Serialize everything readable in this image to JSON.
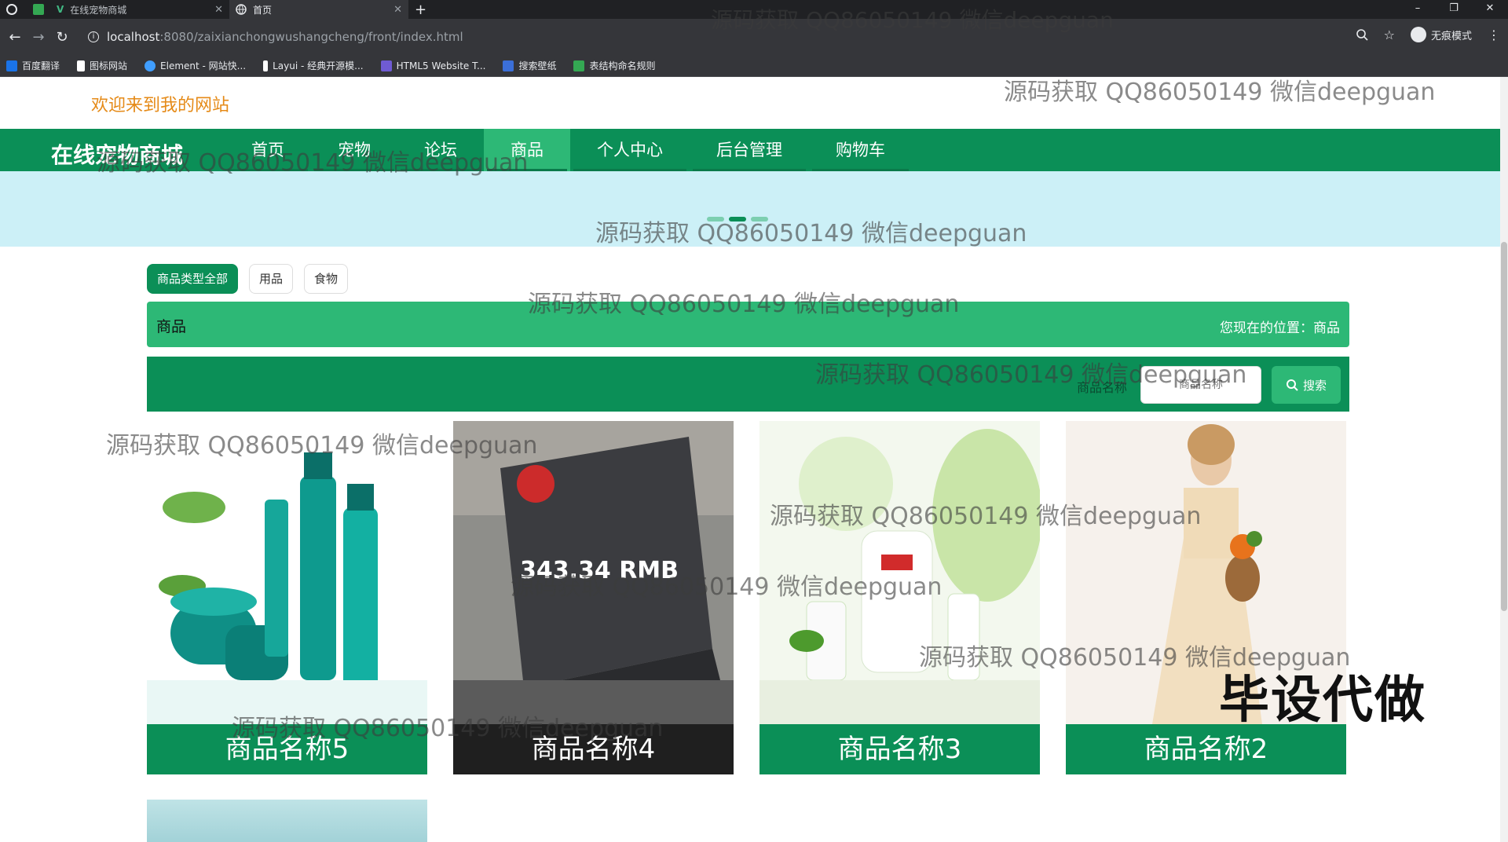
{
  "browser": {
    "tabs": [
      {
        "title": "在线宠物商城",
        "active": false
      },
      {
        "title": "首页",
        "active": true
      }
    ],
    "new_tab": "+",
    "url_host": "localhost",
    "url_path": ":8080/zaixianchongwushangcheng/front/index.html",
    "profile_label": "无痕模式",
    "bookmarks": [
      {
        "label": "百度翻译",
        "color": "#1a73e8"
      },
      {
        "label": "图标网站",
        "color": "#ffffff"
      },
      {
        "label": "Element - 网站快...",
        "color": "#409eff"
      },
      {
        "label": "Layui - 经典开源模...",
        "color": "#ffffff"
      },
      {
        "label": "HTML5 Website T...",
        "color": "#6f5bd3"
      },
      {
        "label": "搜索壁纸",
        "color": "#3b6fd8"
      },
      {
        "label": "表结构命名规则",
        "color": "#34a853"
      }
    ]
  },
  "site": {
    "welcome": "欢迎来到我的网站",
    "logo": "在线宠物商城",
    "nav": [
      {
        "label": "首页",
        "active": false
      },
      {
        "label": "宠物",
        "active": false
      },
      {
        "label": "论坛",
        "active": false
      },
      {
        "label": "商品",
        "active": true
      },
      {
        "label": "个人中心",
        "active": false
      },
      {
        "label": "后台管理",
        "active": false
      },
      {
        "label": "购物车",
        "active": false
      }
    ],
    "filters": [
      {
        "label": "商品类型全部",
        "active": true
      },
      {
        "label": "用品",
        "active": false
      },
      {
        "label": "食物",
        "active": false
      }
    ],
    "crumb_title": "商品",
    "location_text": "您现在的位置：商品",
    "search": {
      "label": "商品名称",
      "placeholder": "商品名称",
      "button": "搜索"
    },
    "products": [
      {
        "name": "商品名称5",
        "theme": "teal-cosmetics"
      },
      {
        "name": "商品名称4",
        "theme": "laptop"
      },
      {
        "name": "商品名称3",
        "theme": "green-bottles"
      },
      {
        "name": "商品名称2",
        "theme": "dress"
      }
    ],
    "laptop_overlay_text": "343.34 RMB",
    "colors": {
      "primary": "#0b8f57",
      "accent": "#2db876",
      "welcome": "#e58a17"
    }
  },
  "overlays": {
    "watermark": "源码获取 QQ86050149 微信deepguan",
    "corner_tag": "毕设代做"
  }
}
